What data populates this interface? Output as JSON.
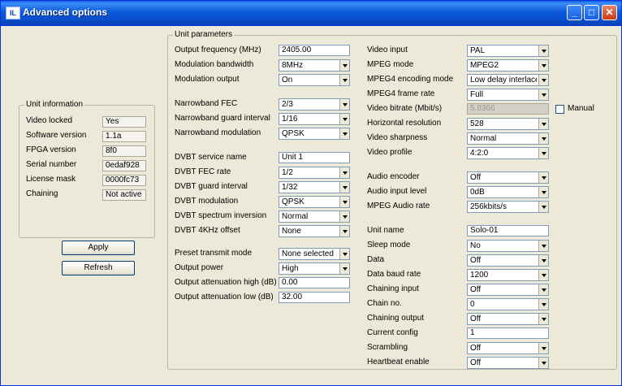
{
  "window": {
    "title": "Advanced options",
    "icon_text": "IL"
  },
  "unit_info": {
    "legend": "Unit information",
    "rows": [
      {
        "label": "Video locked",
        "value": "Yes"
      },
      {
        "label": "Software version",
        "value": "1.1a"
      },
      {
        "label": "FPGA version",
        "value": "8f0"
      },
      {
        "label": "Serial number",
        "value": "0edaf928"
      },
      {
        "label": "License mask",
        "value": "0000fc73"
      },
      {
        "label": "Chaining",
        "value": "Not active"
      }
    ]
  },
  "buttons": {
    "apply": "Apply",
    "refresh": "Refresh"
  },
  "unit_params": {
    "legend": "Unit parameters",
    "output_frequency": {
      "label": "Output frequency (MHz)",
      "value": "2405.00"
    },
    "modulation_bandwidth": {
      "label": "Modulation bandwidth",
      "value": "8MHz"
    },
    "modulation_output": {
      "label": "Modulation output",
      "value": "On"
    },
    "narrowband_fec": {
      "label": "Narrowband FEC",
      "value": "2/3"
    },
    "narrowband_guard": {
      "label": "Narrowband guard interval",
      "value": "1/16"
    },
    "narrowband_modulation": {
      "label": "Narrowband modulation",
      "value": "QPSK"
    },
    "dvbt_service_name": {
      "label": "DVBT service name",
      "value": "Unit 1"
    },
    "dvbt_fec": {
      "label": "DVBT FEC rate",
      "value": "1/2"
    },
    "dvbt_guard": {
      "label": "DVBT guard interval",
      "value": "1/32"
    },
    "dvbt_modulation": {
      "label": "DVBT modulation",
      "value": "QPSK"
    },
    "dvbt_spectrum": {
      "label": "DVBT spectrum inversion",
      "value": "Normal"
    },
    "dvbt_4khz": {
      "label": "DVBT 4KHz offset",
      "value": "None"
    },
    "preset_mode": {
      "label": "Preset transmit mode",
      "value": "None selected"
    },
    "output_power": {
      "label": "Output power",
      "value": "High"
    },
    "atten_high": {
      "label": "Output attenuation high (dB)",
      "value": "0.00"
    },
    "atten_low": {
      "label": "Output attenuation low (dB)",
      "value": "32.00"
    },
    "video_input": {
      "label": "Video input",
      "value": "PAL"
    },
    "mpeg_mode": {
      "label": "MPEG mode",
      "value": "MPEG2"
    },
    "mpeg4_encoding": {
      "label": "MPEG4 encoding mode",
      "value": "Low delay interlace"
    },
    "mpeg4_frame_rate": {
      "label": "MPEG4 frame rate",
      "value": "Full"
    },
    "video_bitrate": {
      "label": "Video bitrate (Mbit/s)",
      "value": "5.8366"
    },
    "manual": {
      "label": "Manual",
      "checked": false
    },
    "horizontal_resolution": {
      "label": "Horizontal resolution",
      "value": "528"
    },
    "video_sharpness": {
      "label": "Video sharpness",
      "value": "Normal"
    },
    "video_profile": {
      "label": "Video profile",
      "value": "4:2:0"
    },
    "audio_encoder": {
      "label": "Audio encoder",
      "value": "Off"
    },
    "audio_input_level": {
      "label": "Audio input level",
      "value": "0dB"
    },
    "mpeg_audio_rate": {
      "label": "MPEG Audio rate",
      "value": "256kbits/s"
    },
    "unit_name": {
      "label": "Unit name",
      "value": "Solo-01"
    },
    "sleep_mode": {
      "label": "Sleep mode",
      "value": "No"
    },
    "data": {
      "label": "Data",
      "value": "Off"
    },
    "data_baud_rate": {
      "label": "Data baud rate",
      "value": "1200"
    },
    "chaining_input": {
      "label": "Chaining input",
      "value": "Off"
    },
    "chain_no": {
      "label": "Chain no.",
      "value": "0"
    },
    "chaining_output": {
      "label": "Chaining output",
      "value": "Off"
    },
    "current_config": {
      "label": "Current config",
      "value": "1"
    },
    "scrambling": {
      "label": "Scrambling",
      "value": "Off"
    },
    "heartbeat_enable": {
      "label": "Heartbeat enable",
      "value": "Off"
    }
  }
}
